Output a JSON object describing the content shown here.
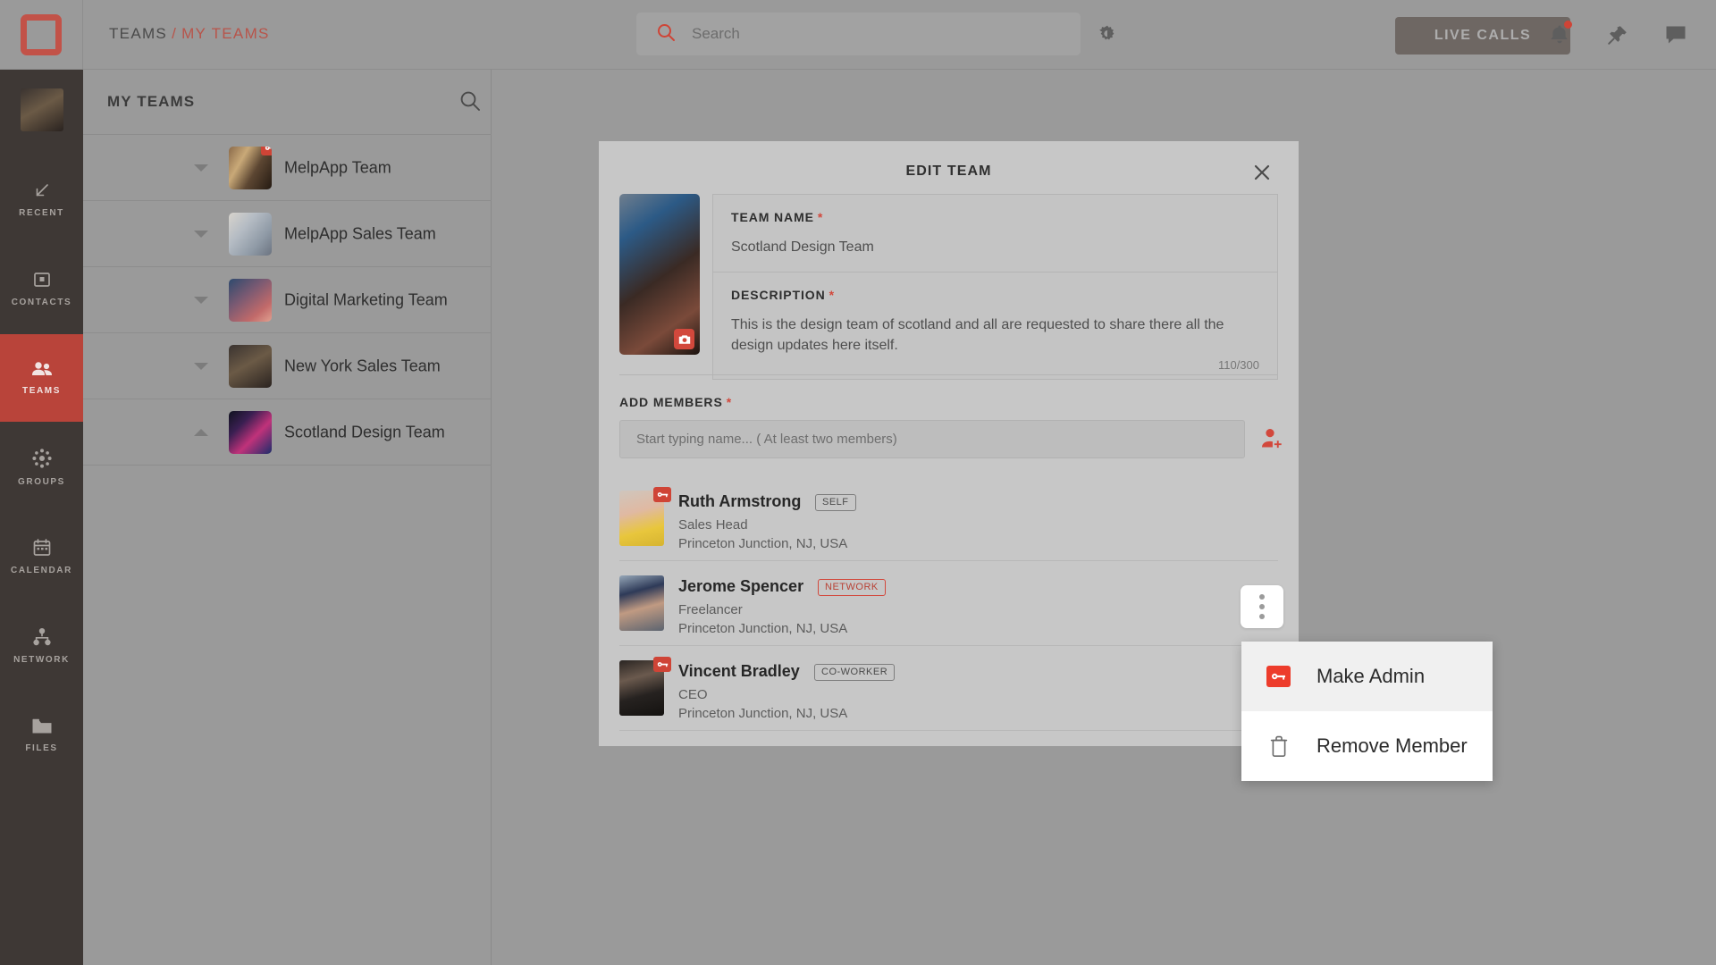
{
  "header": {
    "logo_icon": "app-logo-square",
    "breadcrumb": {
      "root": "TEAMS",
      "separator": "/",
      "current": "MY TEAMS"
    },
    "search": {
      "placeholder": "Search",
      "value": "",
      "icon": "search-icon"
    },
    "settings_icon": "gear-icon",
    "live_calls_label": "LIVE CALLS",
    "icons": [
      {
        "name": "notifications-bell-icon",
        "has_badge": true
      },
      {
        "name": "pin-icon",
        "has_badge": false
      },
      {
        "name": "chat-bubble-icon",
        "has_badge": false
      }
    ],
    "accent_color": "#cf4436",
    "bar_color": "#9a9a9a"
  },
  "rail": {
    "background": "#3e3835",
    "active_color": "#b9443a",
    "avatar_name": "user-avatar",
    "items": [
      {
        "label": "RECENT",
        "icon": "arrow-down-left-icon",
        "active": false
      },
      {
        "label": "CONTACTS",
        "icon": "contact-card-icon",
        "active": false
      },
      {
        "label": "TEAMS",
        "icon": "teams-people-icon",
        "active": true
      },
      {
        "label": "GROUPS",
        "icon": "groups-network-icon",
        "active": false
      },
      {
        "label": "CALENDAR",
        "icon": "calendar-icon",
        "active": false
      },
      {
        "label": "NETWORK",
        "icon": "network-node-icon",
        "active": false
      },
      {
        "label": "FILES",
        "icon": "folder-icon",
        "active": false
      }
    ]
  },
  "teams_panel": {
    "title": "MY TEAMS",
    "search_icon": "search-icon",
    "add_team_icon": "add-people-icon",
    "teams": [
      {
        "name": "MelpApp Team",
        "expanded": false,
        "admin_key": true,
        "dots_red": true,
        "thumb": "ph1"
      },
      {
        "name": "MelpApp Sales Team",
        "expanded": false,
        "admin_key": false,
        "dots_red": false,
        "thumb": "ph2"
      },
      {
        "name": "Digital Marketing Team",
        "expanded": false,
        "admin_key": false,
        "dots_red": false,
        "thumb": "ph3"
      },
      {
        "name": "New York Sales Team",
        "expanded": false,
        "admin_key": false,
        "dots_red": false,
        "thumb": "ph4"
      },
      {
        "name": "Scotland Design Team",
        "expanded": true,
        "admin_key": false,
        "dots_red": false,
        "thumb": "ph5"
      }
    ]
  },
  "modal": {
    "title": "EDIT TEAM",
    "close_icon": "close-icon",
    "photo": {
      "name": "team-cover-photo",
      "camera_badge_icon": "camera-icon"
    },
    "team_name": {
      "label": "TEAM NAME",
      "required": "*",
      "value": "Scotland Design Team"
    },
    "description": {
      "label": "DESCRIPTION",
      "required": "*",
      "value": "This is the design team of scotland and all are requested to share there all the design updates here itself.",
      "char_count": "110/300"
    },
    "add_members": {
      "label": "ADD MEMBERS",
      "required": "*",
      "placeholder": "Start typing name... ( At least two members)",
      "value": "",
      "add_icon": "add-person-icon"
    },
    "members": [
      {
        "name": "Ruth Armstrong",
        "badge": "SELF",
        "badge_style": "gray",
        "role": "Sales Head",
        "location": "Princeton Junction, NJ, USA",
        "admin_key": true,
        "avatar": "ph-ruth"
      },
      {
        "name": "Jerome Spencer",
        "badge": "NETWORK",
        "badge_style": "red",
        "role": "Freelancer",
        "location": "Princeton Junction, NJ, USA",
        "admin_key": false,
        "avatar": "ph-jer"
      },
      {
        "name": "Vincent Bradley",
        "badge": "CO-WORKER",
        "badge_style": "gray",
        "role": "CEO",
        "location": "Princeton Junction, NJ, USA",
        "admin_key": true,
        "avatar": "ph-vin"
      }
    ]
  },
  "context_menu": {
    "trigger_icon": "kebab-menu-icon",
    "items": [
      {
        "label": "Make Admin",
        "icon": "key-icon",
        "highlighted": true
      },
      {
        "label": "Remove Member",
        "icon": "trash-icon",
        "highlighted": false
      }
    ]
  }
}
